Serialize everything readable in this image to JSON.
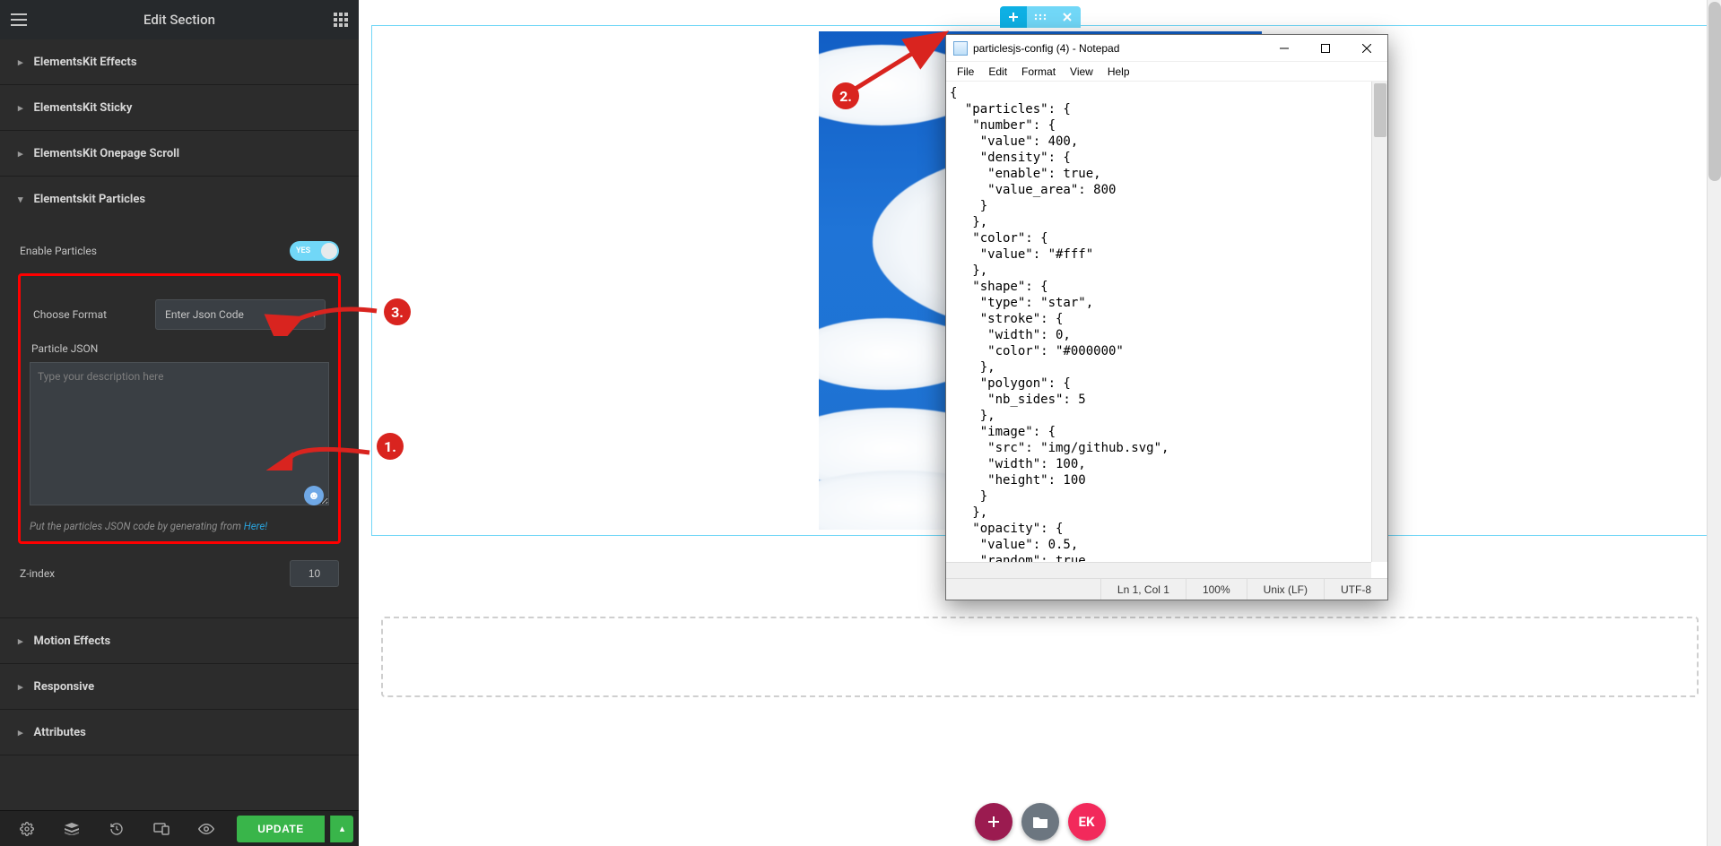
{
  "header": {
    "title": "Edit Section"
  },
  "sidebar": {
    "accordions": {
      "effects": "ElementsKit Effects",
      "sticky": "ElementsKit Sticky",
      "onepage": "ElementsKit Onepage Scroll",
      "particles": "Elementskit Particles",
      "motion": "Motion Effects",
      "responsive": "Responsive",
      "attributes": "Attributes"
    },
    "controls": {
      "enable_particles": "Enable Particles",
      "toggle_yes": "YES",
      "choose_format": "Choose Format",
      "choose_format_value": "Enter Json Code",
      "particle_json": "Particle JSON",
      "textarea_placeholder": "Type your description here",
      "help_prefix": "Put the particles JSON code by generating from ",
      "help_link": "Here!",
      "z_index_label": "Z-index",
      "z_index_value": "10"
    },
    "footer": {
      "update": "UPDATE"
    }
  },
  "annotations": {
    "n1": "1.",
    "n2": "2.",
    "n3": "3."
  },
  "floating": {
    "ek": "EK"
  },
  "notepad": {
    "title": "particlesjs-config (4) - Notepad",
    "menus": {
      "file": "File",
      "edit": "Edit",
      "format": "Format",
      "view": "View",
      "help": "Help"
    },
    "content": "{\n  \"particles\": {\n   \"number\": {\n    \"value\": 400,\n    \"density\": {\n     \"enable\": true,\n     \"value_area\": 800\n    }\n   },\n   \"color\": {\n    \"value\": \"#fff\"\n   },\n   \"shape\": {\n    \"type\": \"star\",\n    \"stroke\": {\n     \"width\": 0,\n     \"color\": \"#000000\"\n    },\n    \"polygon\": {\n     \"nb_sides\": 5\n    },\n    \"image\": {\n     \"src\": \"img/github.svg\",\n     \"width\": 100,\n     \"height\": 100\n    }\n   },\n   \"opacity\": {\n    \"value\": 0.5,\n    \"random\": true,",
    "status": {
      "pos": "Ln 1, Col 1",
      "zoom": "100%",
      "eol": "Unix (LF)",
      "enc": "UTF-8"
    }
  }
}
